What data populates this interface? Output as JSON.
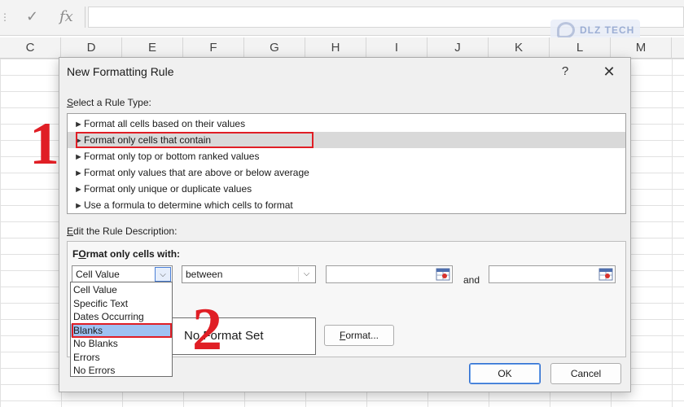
{
  "excel": {
    "formula_bar": {
      "check_icon": "✓",
      "fx_icon": "fx",
      "value": ""
    },
    "columns": [
      "C",
      "D",
      "E",
      "F",
      "G",
      "H",
      "I",
      "J",
      "K",
      "L",
      "M"
    ],
    "watermark": "DLZ TECH"
  },
  "dialog": {
    "title": "New Formatting Rule",
    "help": "?",
    "close": "✕",
    "rule_type_label": {
      "accel": "S",
      "rest": "elect a Rule Type:"
    },
    "rule_types": [
      {
        "label": "Format all cells based on their values",
        "selected": false
      },
      {
        "label": "Format only cells that contain",
        "selected": true
      },
      {
        "label": "Format only top or bottom ranked values",
        "selected": false
      },
      {
        "label": "Format only values that are above or below average",
        "selected": false
      },
      {
        "label": "Format only unique or duplicate values",
        "selected": false
      },
      {
        "label": "Use a formula to determine which cells to format",
        "selected": false
      }
    ],
    "edit_label": {
      "accel": "E",
      "rest": "dit the Rule Description:"
    },
    "description": {
      "heading": {
        "accel": "O",
        "before": "F",
        "rest": "rmat only cells with:"
      },
      "condition_type": "Cell Value",
      "operator": "between",
      "value1": "",
      "and_label": "and",
      "value2": "",
      "preview_text": "No Format Set",
      "format_button": {
        "accel": "F",
        "rest": "ormat..."
      }
    },
    "ok": "OK",
    "cancel": "Cancel"
  },
  "dropdown": {
    "options": [
      "Cell Value",
      "Specific Text",
      "Dates Occurring",
      "Blanks",
      "No Blanks",
      "Errors",
      "No Errors"
    ],
    "selected": "Blanks"
  },
  "annotations": [
    "1",
    "2"
  ],
  "colors": {
    "annotation_red": "#e01e25",
    "selection_blue": "#9fc2f2",
    "primary_border": "#2f6fd1"
  }
}
